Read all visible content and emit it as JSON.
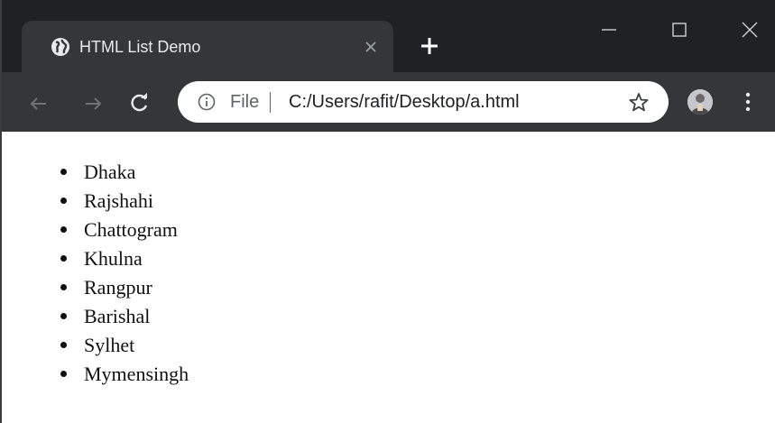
{
  "browser": {
    "tab": {
      "title": "HTML List Demo",
      "favicon": "globe-icon",
      "close_icon": "close-icon"
    },
    "new_tab_icon": "plus-icon",
    "window_controls": [
      "minimize-icon",
      "maximize-icon",
      "close-icon"
    ],
    "toolbar": {
      "back_icon": "arrow-left-icon",
      "forward_icon": "arrow-right-icon",
      "reload_icon": "reload-icon",
      "address_bar": {
        "info_icon": "info-icon",
        "scheme_label": "File",
        "url": "C:/Users/rafit/Desktop/a.html",
        "bookmark_icon": "star-icon"
      },
      "profile_icon": "avatar-icon",
      "menu_icon": "kebab-menu-icon"
    },
    "colors": {
      "tabstrip": "#202124",
      "active_tab": "#35363a",
      "toolbar": "#35363a",
      "omnibox": "#ffffff"
    }
  },
  "page": {
    "list": [
      {
        "label": "Dhaka"
      },
      {
        "label": "Rajshahi"
      },
      {
        "label": "Chattogram"
      },
      {
        "label": "Khulna"
      },
      {
        "label": "Rangpur"
      },
      {
        "label": "Barishal"
      },
      {
        "label": "Sylhet"
      },
      {
        "label": "Mymensingh"
      }
    ]
  }
}
